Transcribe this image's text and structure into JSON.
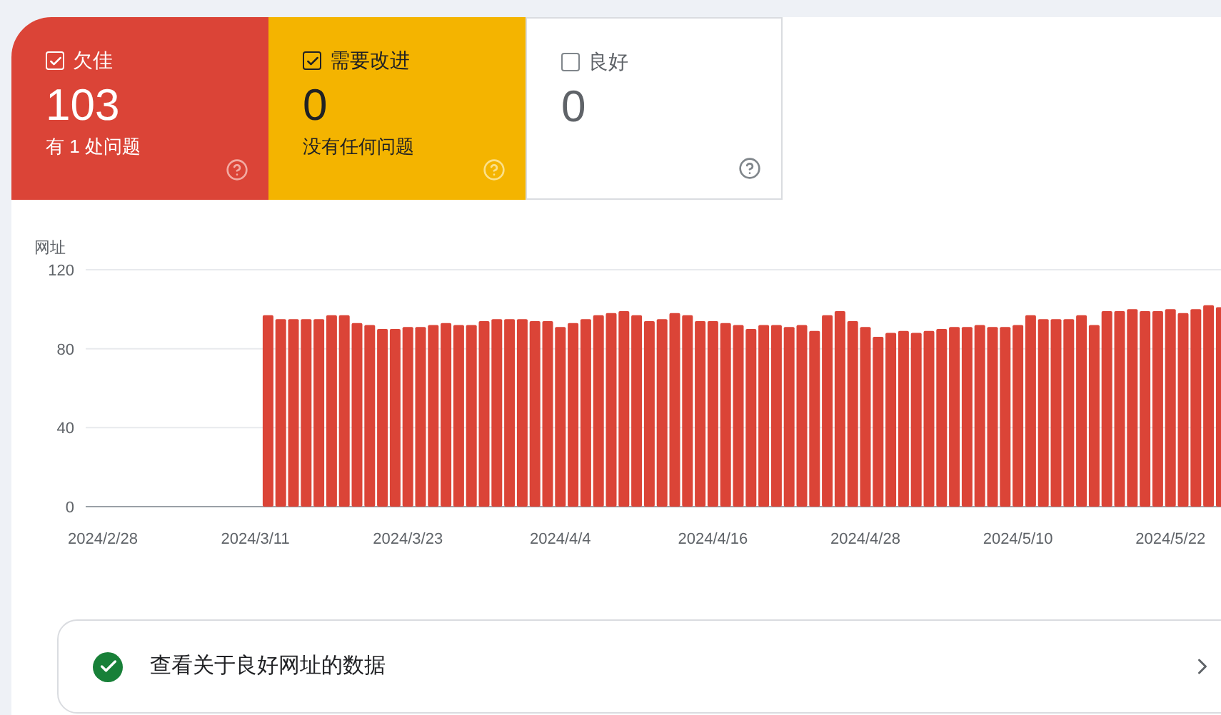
{
  "summary_cards": [
    {
      "kind": "poor",
      "label": "欠佳",
      "checked": true,
      "count": "103",
      "description": "有 1 处问题"
    },
    {
      "kind": "needs_improvement",
      "label": "需要改进",
      "checked": true,
      "count": "0",
      "description": "没有任何问题"
    },
    {
      "kind": "good",
      "label": "良好",
      "checked": false,
      "count": "0"
    }
  ],
  "chart": {
    "chart_data": {
      "type": "bar",
      "ylabel": "网址",
      "ylim": [
        0,
        120
      ],
      "yticks": [
        0,
        40,
        80,
        120
      ],
      "categories": [
        "2024/2/28",
        null,
        null,
        null,
        null,
        null,
        null,
        null,
        null,
        null,
        null,
        null,
        "2024/3/11",
        null,
        null,
        null,
        null,
        null,
        null,
        null,
        null,
        null,
        null,
        null,
        "2024/3/23",
        null,
        null,
        null,
        null,
        null,
        null,
        null,
        null,
        null,
        null,
        null,
        "2024/4/4",
        null,
        null,
        null,
        null,
        null,
        null,
        null,
        null,
        null,
        null,
        null,
        "2024/4/16",
        null,
        null,
        null,
        null,
        null,
        null,
        null,
        null,
        null,
        null,
        null,
        "2024/4/28",
        null,
        null,
        null,
        null,
        null,
        null,
        null,
        null,
        null,
        null,
        null,
        "2024/5/10",
        null,
        null,
        null,
        null,
        null,
        null,
        null,
        null,
        null,
        null,
        null,
        "2024/5/22",
        null,
        null,
        null,
        null
      ],
      "series": [
        {
          "color": "#db4437",
          "values": [
            null,
            null,
            null,
            null,
            null,
            null,
            null,
            null,
            null,
            null,
            null,
            null,
            null,
            97,
            95,
            95,
            95,
            95,
            97,
            97,
            93,
            92,
            90,
            90,
            91,
            91,
            92,
            93,
            92,
            92,
            94,
            95,
            95,
            95,
            94,
            94,
            91,
            93,
            95,
            97,
            98,
            99,
            97,
            94,
            95,
            98,
            97,
            94,
            94,
            93,
            92,
            90,
            92,
            92,
            91,
            92,
            89,
            97,
            99,
            94,
            91,
            86,
            88,
            89,
            88,
            89,
            90,
            91,
            91,
            92,
            91,
            91,
            92,
            97,
            95,
            95,
            95,
            97,
            92,
            99,
            99,
            100,
            99,
            99,
            100,
            98,
            100,
            102,
            101
          ]
        }
      ]
    }
  },
  "good_urls_link": {
    "label": "查看关于良好网址的数据"
  }
}
